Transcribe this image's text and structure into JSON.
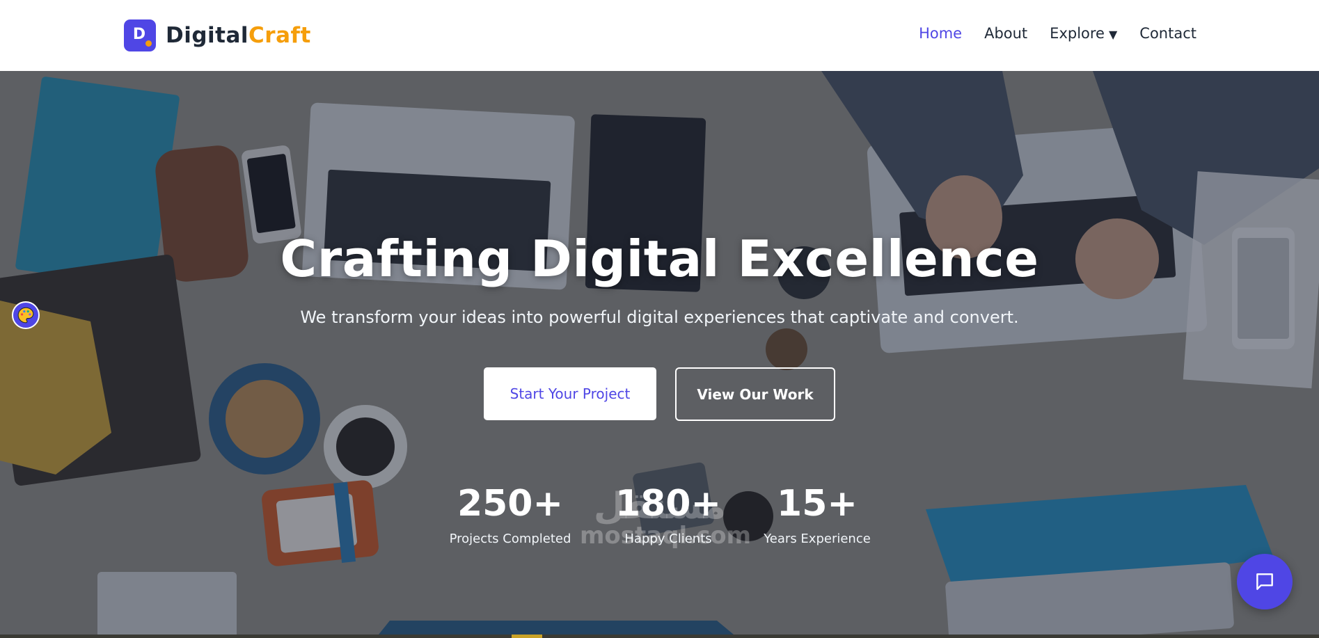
{
  "brand": {
    "logo_letter": "D",
    "name_part_1": "Digital",
    "name_part_2": "Craft"
  },
  "nav": {
    "items": [
      {
        "label": "Home",
        "active": true
      },
      {
        "label": "About",
        "active": false
      },
      {
        "label": "Explore",
        "active": false,
        "dropdown": true
      },
      {
        "label": "Contact",
        "active": false
      }
    ],
    "dropdown_caret": "▼"
  },
  "hero": {
    "title": "Crafting Digital Excellence",
    "subtitle": "We transform your ideas into powerful digital experiences that captivate and convert.",
    "primary_button": "Start Your Project",
    "secondary_button": "View Our Work",
    "background_image": "overhead view of a workspace table with laptops, notebooks, phones and hands typing"
  },
  "stats": [
    {
      "value": "250+",
      "label": "Projects Completed"
    },
    {
      "value": "180+",
      "label": "Happy Clients"
    },
    {
      "value": "15+",
      "label": "Years Experience"
    }
  ],
  "watermark": {
    "arabic": "مستقل",
    "latin": "mostaql.com"
  },
  "icons": {
    "accessibility": "palette-icon",
    "chat": "chat-bubble-icon"
  },
  "colors": {
    "accent": "#4f46e5",
    "brand_orange": "#f59e0b",
    "text_dark": "#1f2937",
    "white": "#ffffff"
  }
}
